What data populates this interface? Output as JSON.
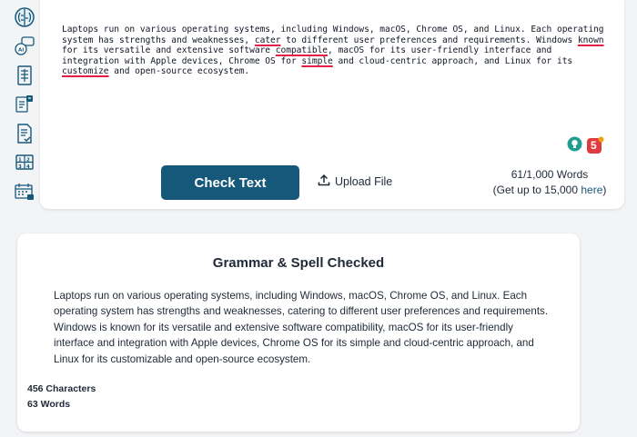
{
  "sidebar": {
    "items": [
      {
        "icon": "brain-icon"
      },
      {
        "icon": "ai-chat-icon"
      },
      {
        "icon": "document-grid-icon"
      },
      {
        "icon": "document-compare-icon"
      },
      {
        "icon": "document-check-icon"
      },
      {
        "icon": "numbers-icon"
      },
      {
        "icon": "calendar-grid-icon"
      }
    ]
  },
  "editor": {
    "segments": [
      "Laptops run on various operating systems, including Windows, macOS, Chrome OS, and Linux. Each operating system has strengths and weaknesses, ",
      "cater",
      " to different user preferences and requirements. Windows ",
      "known",
      " for its versatile and extensive software ",
      "compatible",
      ", macOS for its user-friendly interface and integration with Apple devices, Chrome OS for ",
      "simple",
      " and cloud-centric approach, and Linux for its ",
      "customize",
      " and open-source ecosystem."
    ],
    "error_color": "#e11d48",
    "badge_count": "5"
  },
  "actions": {
    "check_label": "Check Text",
    "upload_label": "Upload File",
    "word_count": "61/1,000 Words",
    "upgrade_prefix": "(Get up to 15,000 ",
    "upgrade_link": "here",
    "upgrade_suffix": ")"
  },
  "result": {
    "title": "Grammar & Spell Checked",
    "text": "Laptops run on various operating systems, including Windows, macOS, Chrome OS, and Linux. Each operating system has strengths and weaknesses, catering to different user preferences and requirements. Windows is known for its versatile and extensive software compatibility, macOS for its user-friendly interface and integration with Apple devices, Chrome OS for its simple and cloud-centric approach, and Linux for its customizable and open-source ecosystem.",
    "characters": "456 Characters",
    "words": "63 Words"
  },
  "colors": {
    "primary": "#16587a",
    "badge_red": "#e03a3e",
    "badge_teal": "#1f9e8f"
  }
}
